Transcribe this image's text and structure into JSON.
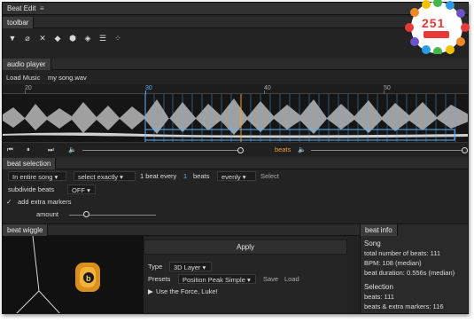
{
  "window": {
    "title": "Beat Edit",
    "menu_icon": "hamburger-icon"
  },
  "toolbar": {
    "tab": "toolbar",
    "tools": [
      {
        "name": "marker-down-icon",
        "glyph": "▼"
      },
      {
        "name": "marker-cut-icon",
        "glyph": "⌀"
      },
      {
        "name": "marker-clear-icon",
        "glyph": "✕"
      },
      {
        "name": "marker-shield-icon",
        "glyph": "◆"
      },
      {
        "name": "marker-select-icon",
        "glyph": "⬢"
      },
      {
        "name": "marker-back-icon",
        "glyph": "◈"
      },
      {
        "name": "lines-icon",
        "glyph": "☰"
      },
      {
        "name": "dots-icon",
        "glyph": "⁘"
      }
    ]
  },
  "audio_player": {
    "tab": "audio player",
    "load_music_label": "Load Music",
    "file_name": "my song.wav",
    "ruler_labels": [
      "20",
      "30",
      "40",
      "50"
    ],
    "beats_label": "beats",
    "speaker_icon": "speaker-icon"
  },
  "beat_selection": {
    "tab": "beat selection",
    "scope_value": "In entire song",
    "select_mode_value": "select exactly",
    "one_beat_every_label": "1 beat every",
    "count_value": "1",
    "beats_label": "beats",
    "distribution_value": "evenly",
    "select_button": "Select",
    "subdivide_label": "subdivide beats",
    "subdivide_value": "OFF",
    "extra_markers_label": "add extra markers",
    "amount_label": "amount"
  },
  "beat_wiggle": {
    "tab": "beat wiggle",
    "apply_label": "Apply",
    "type_label": "Type",
    "type_value": "3D Layer",
    "presets_label": "Presets",
    "presets_value": "Position Peak Simple",
    "save_label": "Save",
    "load_label": "Load",
    "force_label": "Use the Force, Luke!"
  },
  "beat_info": {
    "tab": "beat info",
    "song_title": "Song",
    "total_beats": "total number of beats: 111",
    "bpm": "BPM: 108 (median)",
    "beat_duration": "beat duration: 0.556s (median)",
    "selection_title": "Selection",
    "selection_beats": "beats: 111",
    "selection_extra": "beats & extra markers: 116"
  },
  "badge": {
    "number": "251"
  },
  "colors": {
    "accent_blue": "#5ab2ff",
    "accent_orange": "#f0a030",
    "badge_red": "#e93838",
    "wiggle_logo": "#d9901a"
  }
}
